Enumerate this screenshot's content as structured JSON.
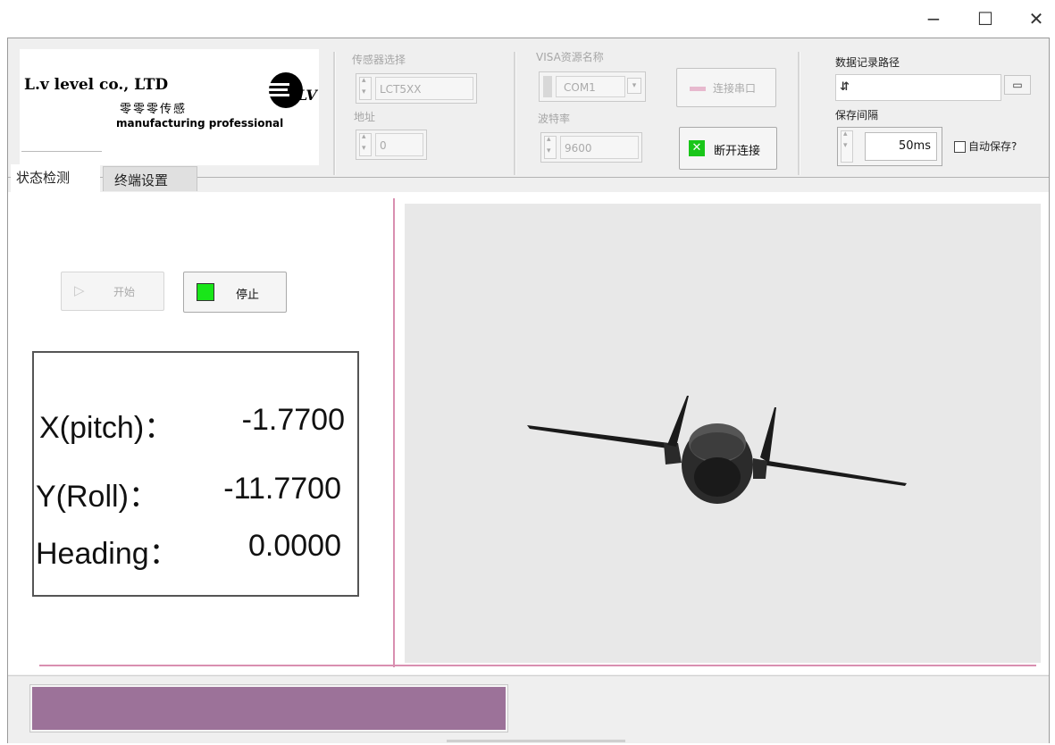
{
  "window": {
    "minimize": "−",
    "maximize": "☐",
    "close": "✕"
  },
  "logo": {
    "company": "L.v level co., LTD",
    "tagline_cn": "零零零传感",
    "tagline_en": "manufacturing professional",
    "mark": "LV"
  },
  "sensor": {
    "label": "传感器选择",
    "value": "LCT5XX",
    "address_label": "地址",
    "address_value": "0"
  },
  "visa": {
    "label": "VISA资源名称",
    "value": "COM1",
    "baud_label": "波特率",
    "baud_value": "9600",
    "connect_label": "连接串口",
    "disconnect_label": "断开连接"
  },
  "logging": {
    "path_label": "数据记录路径",
    "path_value": "",
    "interval_label": "保存间隔",
    "interval_value": "50ms",
    "autosave_label": "自动保存?",
    "autosave_checked": false
  },
  "tabs": [
    {
      "label": "状态检测",
      "active": true
    },
    {
      "label": "终端设置",
      "active": false
    }
  ],
  "controls": {
    "start_label": "开始",
    "stop_label": "停止"
  },
  "readout": {
    "pitch_label": "X(pitch)：",
    "pitch_value": "-1.7700",
    "roll_label": "Y(Roll)：",
    "roll_value": "-11.7700",
    "heading_label": "Heading：",
    "heading_value": "0.0000"
  },
  "progress": {
    "fraction": 1.0
  },
  "colors": {
    "accent_pink": "#d98fb0",
    "progress_fill": "#9c7299",
    "led_green": "#19e619"
  }
}
